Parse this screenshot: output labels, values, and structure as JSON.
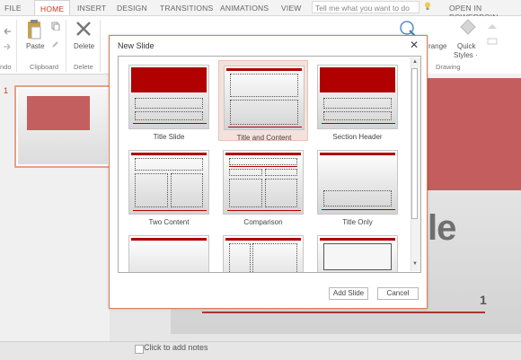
{
  "ribbon": {
    "tabs": [
      "FILE",
      "HOME",
      "INSERT",
      "DESIGN",
      "TRANSITIONS",
      "ANIMATIONS",
      "VIEW"
    ],
    "active_tab": "HOME",
    "tell_me_placeholder": "Tell me what you want to do",
    "open_in_powerpoint": "OPEN IN POWERPOIN",
    "groups": {
      "undo": "ndo",
      "clipboard": "Clipboard",
      "delete": "Delete",
      "drawing": "Drawing"
    },
    "buttons": {
      "paste": "Paste",
      "delete": "Delete",
      "arrange": "range",
      "quick_styles_1": "Quick",
      "quick_styles_2": "Styles ·"
    }
  },
  "thumbnail": {
    "number": "1"
  },
  "slide": {
    "big_text": "le",
    "number": "1"
  },
  "notes": {
    "placeholder": "Click to add notes"
  },
  "dialog": {
    "title": "New Slide",
    "layouts": [
      {
        "label": "Title Slide",
        "selected": false
      },
      {
        "label": "Title and Content",
        "selected": true
      },
      {
        "label": "Section Header",
        "selected": false
      },
      {
        "label": "Two Content",
        "selected": false
      },
      {
        "label": "Comparison",
        "selected": false
      },
      {
        "label": "Title Only",
        "selected": false
      }
    ],
    "add_button": "Add Slide",
    "cancel_button": "Cancel"
  },
  "colors": {
    "accent": "#c43e1c",
    "theme_red": "#b00000",
    "dialog_border": "#e07a58"
  }
}
